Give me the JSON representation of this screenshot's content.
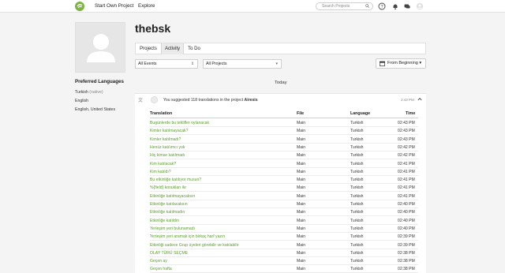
{
  "header": {
    "start_project": "Start Own Project",
    "explore": "Explore",
    "search_placeholder": "Search Projects",
    "icons": [
      "help-icon",
      "bell-icon",
      "messages-icon",
      "user-avatar-icon"
    ]
  },
  "profile": {
    "username": "thebsk"
  },
  "tabs": [
    {
      "label": "Projects"
    },
    {
      "label": "Activity"
    },
    {
      "label": "To Do"
    }
  ],
  "filters": {
    "events": "All Events",
    "projects": "All Projects",
    "from": "From Beginning ▾"
  },
  "languages": {
    "title": "Preferred Languages",
    "native_lang": "Turkish",
    "native_tag": "(native)",
    "items": [
      "English",
      "English, United States"
    ]
  },
  "activity": {
    "day": "Today",
    "summary_prefix": "You suggested 118 translations in the project",
    "project": "Airesis",
    "time": "2:43 PM",
    "columns": {
      "translation": "Translation",
      "file": "File",
      "language": "Language",
      "time": "Time"
    },
    "rows": [
      {
        "translation": "Bugünlerde bu teklifler oylanacak",
        "file": "Main",
        "language": "Turkish",
        "time": "02:43 PM"
      },
      {
        "translation": "Kimler katılmayacak?",
        "file": "Main",
        "language": "Turkish",
        "time": "02:43 PM"
      },
      {
        "translation": "Kimler katılmadı?",
        "file": "Main",
        "language": "Turkish",
        "time": "02:43 PM"
      },
      {
        "translation": "Henüz katılımcı yok",
        "file": "Main",
        "language": "Turkish",
        "time": "02:42 PM"
      },
      {
        "translation": "Hiç kimse katılmadı",
        "file": "Main",
        "language": "Turkish",
        "time": "02:42 PM"
      },
      {
        "translation": "Kim katılacak?",
        "file": "Main",
        "language": "Turkish",
        "time": "02:41 PM"
      },
      {
        "translation": "Kim katıldı?",
        "file": "Main",
        "language": "Turkish",
        "time": "02:41 PM"
      },
      {
        "translation": "Bu etkinliğe katılıyor musun?",
        "file": "Main",
        "language": "Turkish",
        "time": "02:41 PM"
      },
      {
        "translation": "%{field} konukları ile",
        "file": "Main",
        "language": "Turkish",
        "time": "02:41 PM"
      },
      {
        "translation": "Etkinliğe katılmayacaksın",
        "file": "Main",
        "language": "Turkish",
        "time": "02:41 PM"
      },
      {
        "translation": "Etkinliğe katılacaksın",
        "file": "Main",
        "language": "Turkish",
        "time": "02:40 PM"
      },
      {
        "translation": "Etkinliğe katılmadın",
        "file": "Main",
        "language": "Turkish",
        "time": "02:40 PM"
      },
      {
        "translation": "Etkinliğe katıldın",
        "file": "Main",
        "language": "Turkish",
        "time": "02:40 PM"
      },
      {
        "translation": "Yerleşim yeri bulunamadı",
        "file": "Main",
        "language": "Turkish",
        "time": "02:40 PM"
      },
      {
        "translation": "Yerleşim yeri aramak için birkaç harf yazın",
        "file": "Main",
        "language": "Turkish",
        "time": "02:39 PM"
      },
      {
        "translation": "Etkinliği sadece Grup üyeleri görebilir ve katılabilir",
        "file": "Main",
        "language": "Turkish",
        "time": "02:39 PM"
      },
      {
        "translation": "OLAY TÜRÜ SEÇME",
        "file": "Main",
        "language": "Turkish",
        "time": "02:38 PM"
      },
      {
        "translation": "Geçen ay",
        "file": "Main",
        "language": "Turkish",
        "time": "02:38 PM"
      },
      {
        "translation": "Geçen hafta",
        "file": "Main",
        "language": "Turkish",
        "time": "02:38 PM"
      }
    ]
  }
}
